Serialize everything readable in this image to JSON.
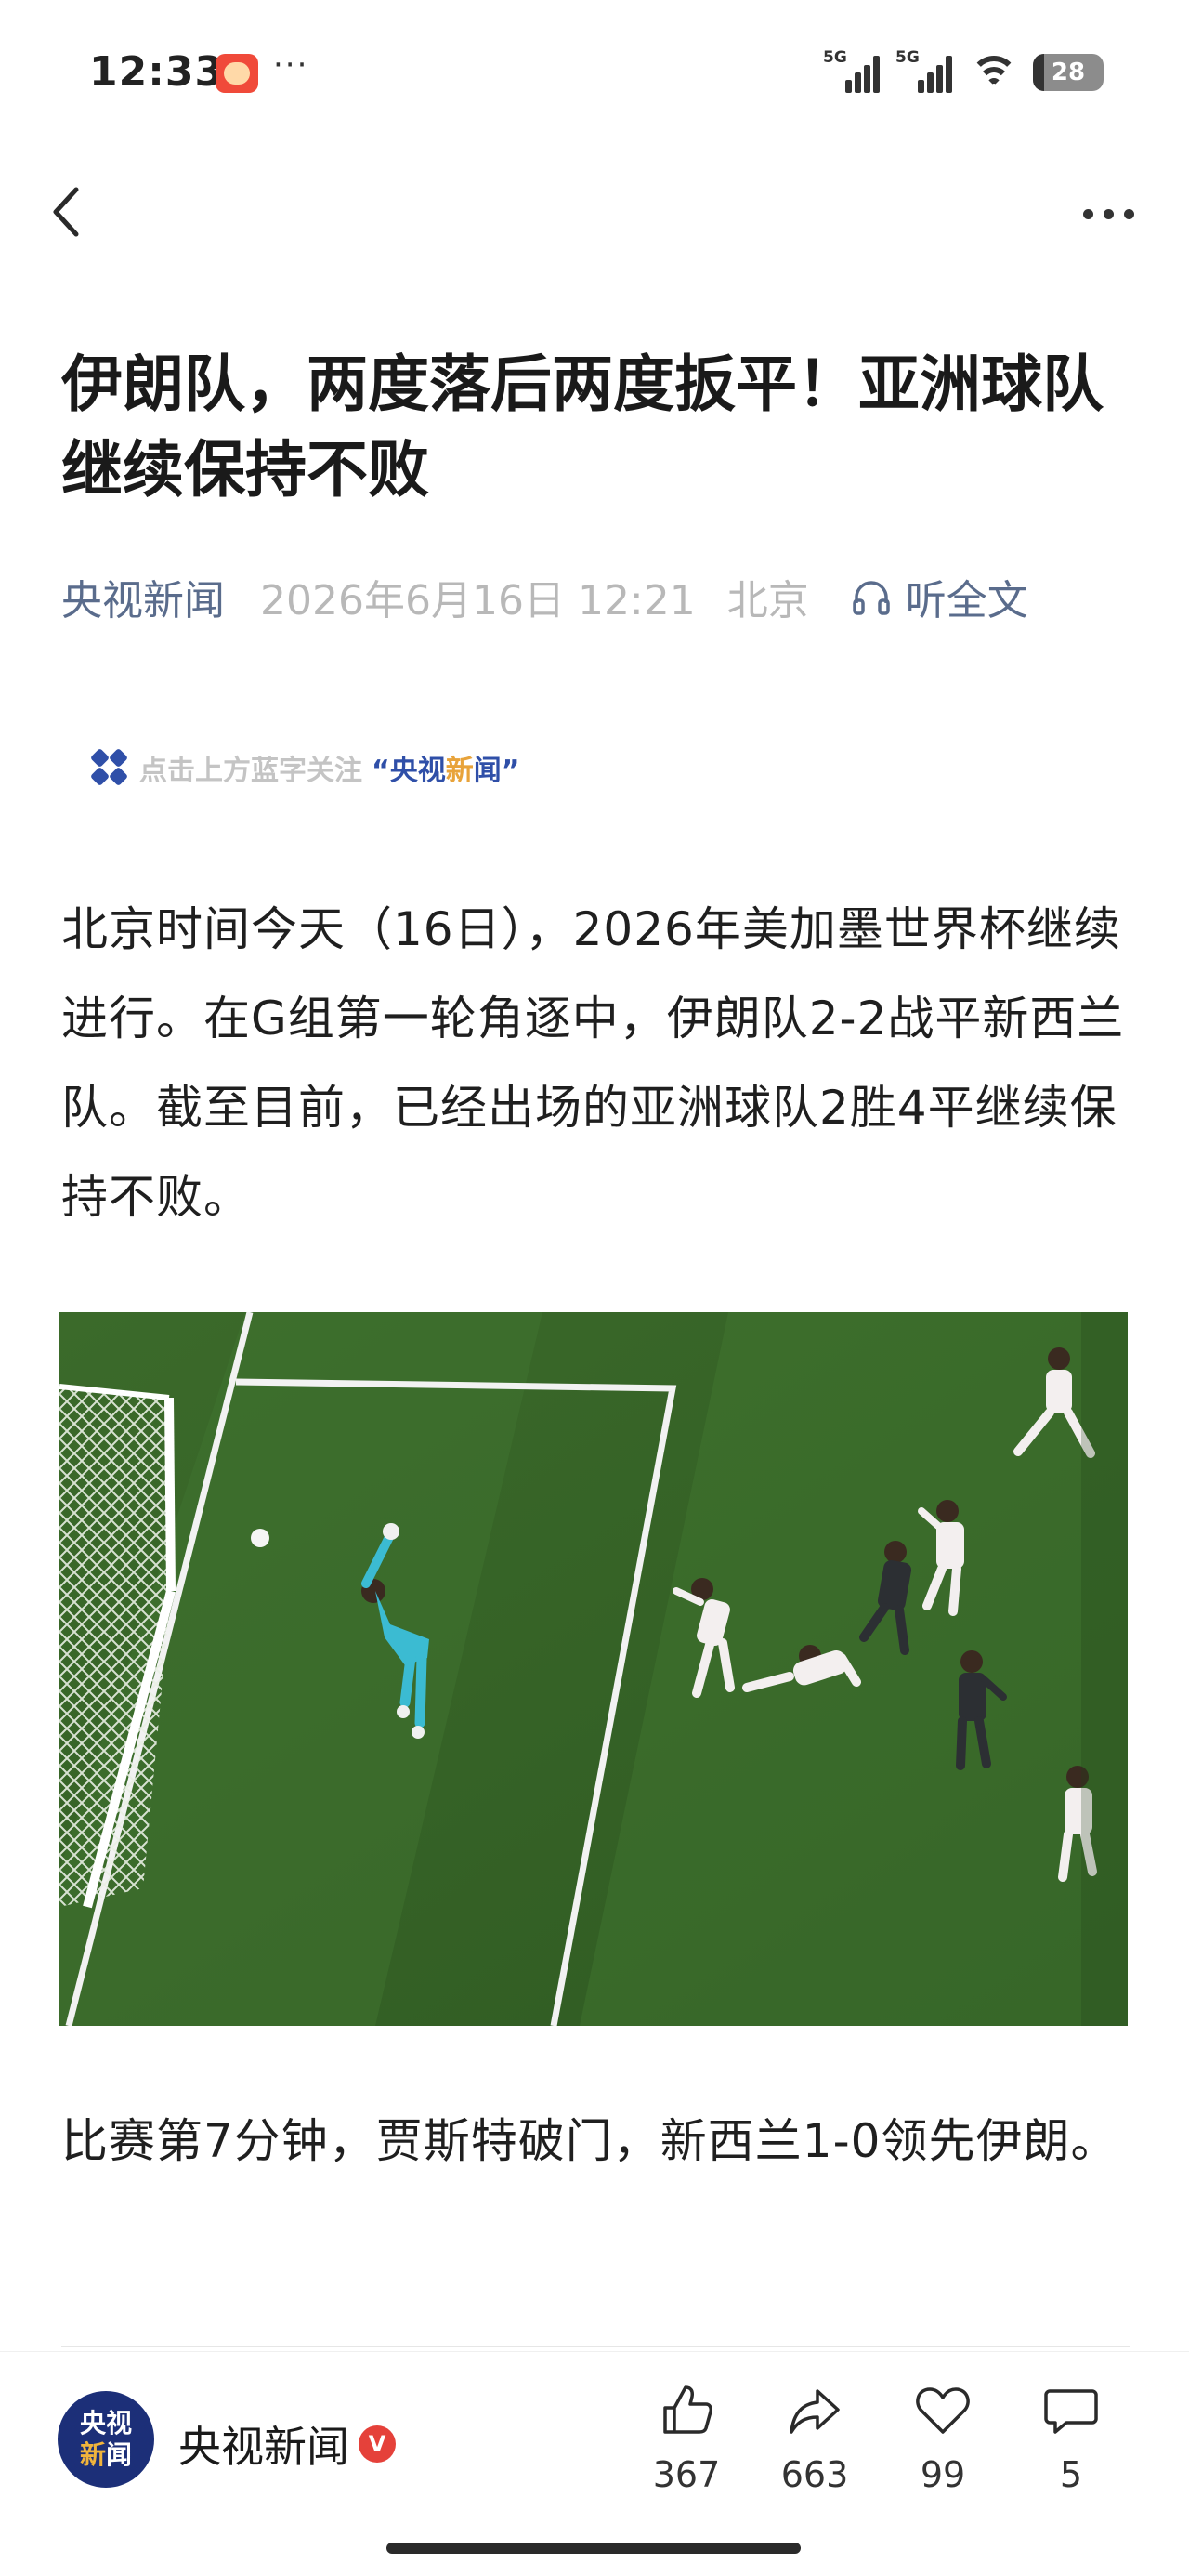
{
  "status_bar": {
    "time": "12:33",
    "app_icon": "weibo-like-app-icon",
    "more": "···",
    "signal1_label": "5G",
    "signal2_label": "5G",
    "wifi_icon": "wifi-icon",
    "battery": "28"
  },
  "nav": {
    "back_icon": "chevron-left-icon",
    "more_icon": "more-dots-icon"
  },
  "article": {
    "title": "伊朗队，两度落后两度扳平！亚洲球队继续保持不败",
    "source": "央视新闻",
    "date": "2026年6月16日 12:21",
    "location": "北京",
    "listen_label": "听全文",
    "follow_text": "点击上方蓝字关注",
    "follow_quote_open": "“央视",
    "follow_quote_highlight": "新",
    "follow_quote_close": "闻”",
    "paragraph1": "北京时间今天（16日），2026年美加墨世界杯继续进行。在G组第一轮角逐中，伊朗队2-2战平新西兰队。截至目前，已经出场的亚洲球队2胜4平继续保持不败。",
    "photo_alt": "soccer-goal-photo",
    "paragraph2": "比赛第7分钟，贾斯特破门，新西兰1-0领先伊朗。"
  },
  "bottom_bar": {
    "avatar_line1": "央视",
    "avatar_line2_a": "新",
    "avatar_line2_b": "闻",
    "author": "央视新闻",
    "verified": "V",
    "actions": [
      {
        "icon": "thumbs-up-icon",
        "count": "367"
      },
      {
        "icon": "share-arrow-icon",
        "count": "663"
      },
      {
        "icon": "heart-icon",
        "count": "99"
      },
      {
        "icon": "comment-icon",
        "count": "5"
      }
    ]
  },
  "colors": {
    "source_blue": "#5a6c8c",
    "meta_gray": "#b8b8b8",
    "brand_navy": "#1c2f78",
    "verified_red": "#e5413a"
  }
}
